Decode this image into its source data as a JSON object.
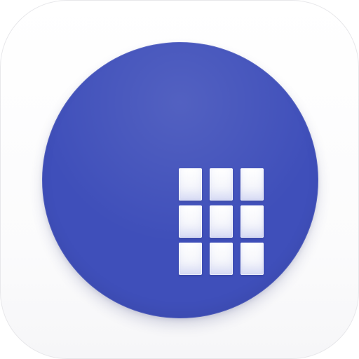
{
  "app_icon": {
    "icon": "grid-icon",
    "colors": {
      "circle": "#3f4fba",
      "tile": "#ffffff",
      "cells": "#f4f5fb"
    }
  }
}
